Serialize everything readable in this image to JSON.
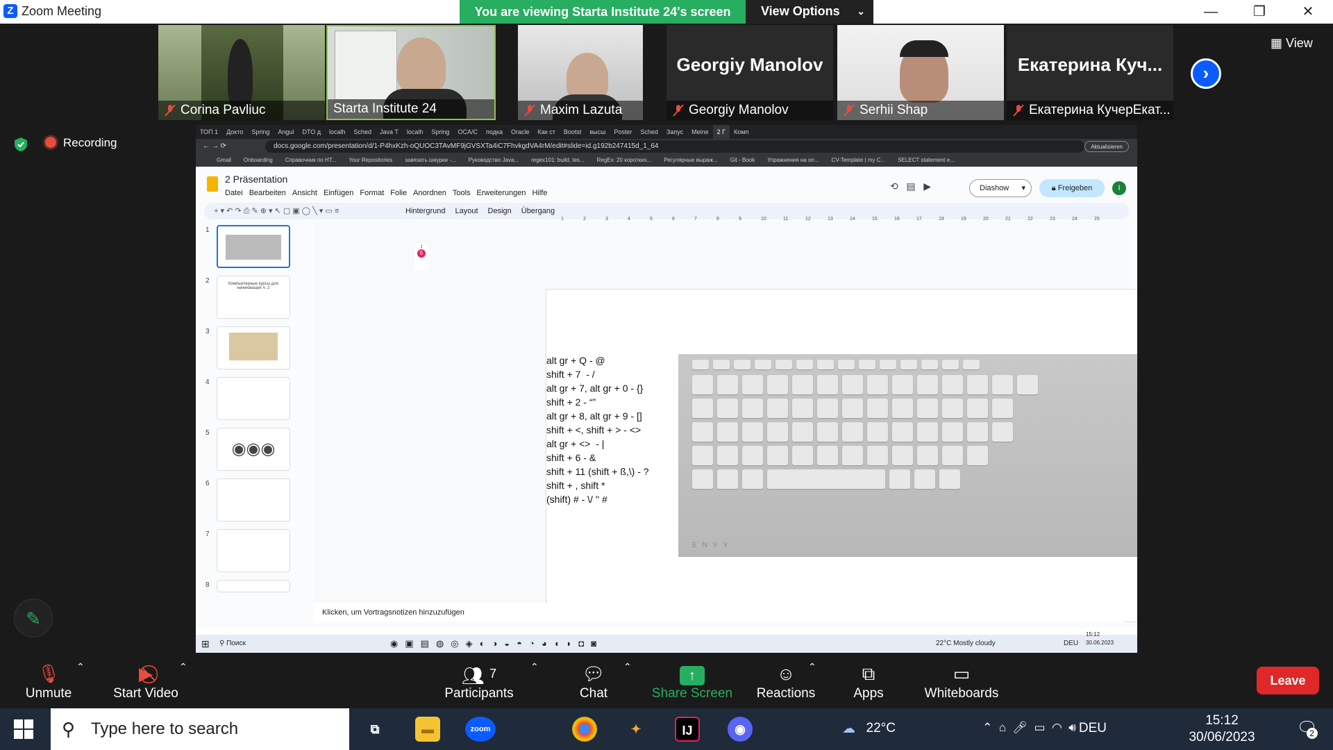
{
  "window": {
    "app_title": "Zoom Meeting"
  },
  "banner": {
    "text": "You are viewing Starta Institute 24's screen",
    "view_options": "View Options"
  },
  "participants_strip": {
    "view_label": "View",
    "tiles": [
      {
        "name": "Corina Pavliuc"
      },
      {
        "name": "Starta Institute 24"
      },
      {
        "name": "Maxim Lazuta"
      },
      {
        "name": "Georgiy Manolov",
        "big_name": "Georgiy Manolov"
      },
      {
        "name": "Serhii Shap"
      },
      {
        "name": "Екатерина КучерЕкат...",
        "big_name": "Екатерина  Куч..."
      }
    ]
  },
  "recording": {
    "label": "Recording"
  },
  "shared": {
    "tabs": [
      "ТОП 1",
      "Докто",
      "Spring",
      "Angul",
      "DTO д",
      "localh",
      "Sched",
      "Java T",
      "localh",
      "Spring",
      "OCA/C",
      "подка",
      "Oracle",
      "Как ст",
      "Bootst",
      "высш",
      "Poster",
      "Sched",
      "Запус",
      "Meine",
      "2 Г",
      "Комп"
    ],
    "url": "docs.google.com/presentation/d/1-P4hxKzh-oQUOC3TAvMF9jGVSXTa4iC7FhvkgdVA4rM/edit#slide=id.g192b247415d_1_64",
    "bookmarks": [
      "Gmail",
      "Onboarding",
      "Справочник по НТ...",
      "Your Repositories",
      "завязать шнурки -...",
      "Руководство Java...",
      "regex101: build, tes...",
      "RegEx: 20 коротких...",
      "Регулярные выраж...",
      "Git - Book",
      "Упражнения на on...",
      "CV-Template | my C...",
      "SELECT statement e..."
    ],
    "update_label": "Aktualisieren",
    "doc_title": "2 Präsentation",
    "menus": [
      "Datei",
      "Bearbeiten",
      "Ansicht",
      "Einfügen",
      "Format",
      "Folie",
      "Anordnen",
      "Tools",
      "Erweiterungen",
      "Hilfe"
    ],
    "diashow": "Diashow",
    "freigeben": "Freigeben",
    "avatar_initial": "I",
    "toolbar": [
      "Hintergrund",
      "Layout",
      "Design",
      "Übergang"
    ],
    "slide_numbers": [
      "1",
      "2",
      "3",
      "4",
      "5",
      "6",
      "7",
      "8"
    ],
    "thumb2_text": "Компьютерные курсы для начинающих ч. 2",
    "slide_text": "alt gr + Q - @\nshift + 7  - /\nalt gr + 7, alt gr + 0 - {}\nshift + 2 - “”\nalt gr + 8, alt gr + 9 - []\nshift + <, shift + > - <>\nalt gr + <>  - |\nshift + 6 - &\nshift + 11 (shift + ß,\\) - ?\nshift + , shift *\n(shift) # - \\/ '' #",
    "kbd_brand": "ENVY",
    "notes_placeholder": "Klicken, um Vortragsnotizen hinzuzufügen",
    "inner_search": "Поиск",
    "inner_weather": "22°C  Mostly cloudy",
    "inner_lang": "DEU",
    "inner_time": "15:12",
    "inner_date": "30.06.2023"
  },
  "controls": {
    "unmute": "Unmute",
    "start_video": "Start Video",
    "participants": "Participants",
    "participants_count": "7",
    "chat": "Chat",
    "share_screen": "Share Screen",
    "reactions": "Reactions",
    "apps": "Apps",
    "whiteboards": "Whiteboards",
    "leave": "Leave"
  },
  "taskbar": {
    "search_placeholder": "Type here to search",
    "zoom_label": "zoom",
    "temp": "22°C",
    "lang": "DEU",
    "time": "15:12",
    "date": "30/06/2023",
    "notif_count": "2"
  },
  "colors": {
    "zoom_blue": "#0b5cff",
    "banner_green": "#27ae60",
    "leave_red": "#e02828"
  }
}
